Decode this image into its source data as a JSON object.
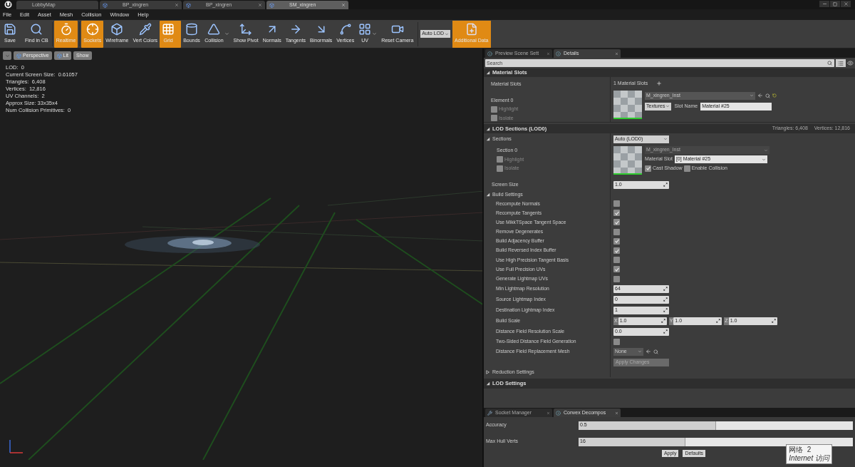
{
  "doc_tabs": [
    {
      "label": "LobbyMap",
      "selected": false,
      "closable": false
    },
    {
      "label": "BP_xingren",
      "selected": false,
      "closable": true
    },
    {
      "label": "BP_xingren",
      "selected": false,
      "closable": true
    },
    {
      "label": "SM_xingren",
      "selected": true,
      "closable": true
    }
  ],
  "menu": [
    "File",
    "Edit",
    "Asset",
    "Mesh",
    "Collision",
    "Window",
    "Help"
  ],
  "toolbar": {
    "items": [
      {
        "label": "Save",
        "on": false,
        "dropdown": false
      },
      {
        "label": "Find in CB",
        "on": false,
        "dropdown": false
      },
      {
        "label": "Realtime",
        "on": true,
        "dropdown": false
      },
      {
        "label": "Sockets",
        "on": true,
        "dropdown": false
      },
      {
        "label": "Wireframe",
        "on": false,
        "dropdown": false
      },
      {
        "label": "Vert Colors",
        "on": false,
        "dropdown": false
      },
      {
        "label": "Grid",
        "on": true,
        "dropdown": false
      },
      {
        "label": "Bounds",
        "on": false,
        "dropdown": false
      },
      {
        "label": "Collision",
        "on": false,
        "dropdown": true
      },
      {
        "label": "Show Pivot",
        "on": false,
        "dropdown": false
      },
      {
        "label": "Normals",
        "on": false,
        "dropdown": false
      },
      {
        "label": "Tangents",
        "on": false,
        "dropdown": false
      },
      {
        "label": "Binormals",
        "on": false,
        "dropdown": false
      },
      {
        "label": "Vertices",
        "on": false,
        "dropdown": false
      },
      {
        "label": "UV",
        "on": false,
        "dropdown": true
      },
      {
        "label": "Reset Camera",
        "on": false,
        "dropdown": false
      }
    ],
    "lod_dropdown": "Auto LOD",
    "additional": {
      "label": "Additional Data",
      "on": true
    }
  },
  "viewport": {
    "buttons": [
      "Perspective",
      "Lit",
      "Show"
    ],
    "stats": [
      "LOD:  0",
      "Current Screen Size:  0.61057",
      "Triangles:  6,408",
      "Vertices:  12,816",
      "UV Channels:  2",
      "Approx Size: 33x35x4",
      "Num Collision Primitives:  0"
    ]
  },
  "details_tabs": [
    {
      "label": "Preview Scene Sett",
      "selected": false
    },
    {
      "label": "Details",
      "selected": true
    }
  ],
  "search": {
    "placeholder": "Search"
  },
  "material_slots": {
    "header": "Material Slots",
    "expanded": true,
    "label": "Material Slots",
    "count": "1 Material Slots",
    "element": {
      "label": "Element 0",
      "highlight": {
        "label": "Highlight",
        "checked": false
      },
      "isolate": {
        "label": "Isolate",
        "checked": false
      },
      "material": "M_xingren_Inst",
      "textures": "Textures",
      "slot_name_label": "Slot Name",
      "slot_name": "Material #25"
    }
  },
  "lod_sections": {
    "header": "LOD Sections (LOD0)",
    "expanded": true,
    "triangles": "Triangles: 6,408",
    "vertices": "Vertices: 12,816",
    "sections_label": "Sections",
    "sections_expanded": true,
    "sections_value": "Auto (LOD0)",
    "section": {
      "label": "Section 0",
      "highlight": {
        "label": "Highlight",
        "checked": false
      },
      "isolate": {
        "label": "Isolate",
        "checked": false
      },
      "material": "M_xingren_Inst",
      "material_disabled": true,
      "slot_label": "Material Slot",
      "slot_value": "[0] Material #25",
      "cast_shadow": {
        "label": "Cast Shadow",
        "checked": true
      },
      "enable_collision": {
        "label": "Enable Collision",
        "checked": false
      }
    },
    "screen_size_label": "Screen Size",
    "screen_size": "1.0",
    "build_settings": {
      "label": "Build Settings",
      "expanded": true,
      "rows": [
        {
          "kind": "checkbox",
          "label": "Recompute Normals",
          "checked": false
        },
        {
          "kind": "checkbox",
          "label": "Recompute Tangents",
          "checked": true
        },
        {
          "kind": "checkbox",
          "label": "Use MikkTSpace Tangent Space",
          "checked": true
        },
        {
          "kind": "checkbox",
          "label": "Remove Degenerates",
          "checked": false
        },
        {
          "kind": "checkbox",
          "label": "Build Adjacency Buffer",
          "checked": true
        },
        {
          "kind": "checkbox",
          "label": "Build Reversed Index Buffer",
          "checked": true
        },
        {
          "kind": "checkbox",
          "label": "Use High Precision Tangent Basis",
          "checked": false
        },
        {
          "kind": "checkbox",
          "label": "Use Full Precision UVs",
          "checked": true
        },
        {
          "kind": "checkbox",
          "label": "Generate Lightmap UVs",
          "checked": false
        },
        {
          "kind": "number",
          "label": "Min Lightmap Resolution",
          "value": "64"
        },
        {
          "kind": "number",
          "label": "Source Lightmap Index",
          "value": "0"
        },
        {
          "kind": "number",
          "label": "Destination Lightmap Index",
          "value": "1"
        },
        {
          "kind": "vector",
          "label": "Build Scale",
          "axes": [
            {
              "axis": "X",
              "value": "1.0"
            },
            {
              "axis": "Y",
              "value": "1.0"
            },
            {
              "axis": "Z",
              "value": "1.0"
            }
          ]
        },
        {
          "kind": "number",
          "label": "Distance Field Resolution Scale",
          "value": "0.0"
        },
        {
          "kind": "checkbox",
          "label": "Two-Sided Distance Field Generation",
          "checked": false
        },
        {
          "kind": "asset",
          "label": "Distance Field Replacement Mesh",
          "value": "None"
        },
        {
          "kind": "button",
          "value": "Apply Changes"
        }
      ]
    },
    "reduction": {
      "label": "Reduction Settings",
      "expanded": false
    }
  },
  "lod_settings": {
    "header": "LOD Settings",
    "expanded": true
  },
  "bottom_tabs": [
    {
      "label": "Socket Manager",
      "selected": false
    },
    {
      "label": "Convex Decompos",
      "selected": true
    }
  ],
  "convex": {
    "rows": [
      {
        "label": "Accuracy",
        "value": "0.5",
        "level": 0.5
      },
      {
        "label": "Max Hull Verts",
        "value": "16",
        "level": 0.39
      }
    ],
    "buttons": [
      "Apply",
      "Defaults"
    ]
  },
  "tooltip": {
    "title": "网络  2",
    "subtitle": "Internet 访问"
  }
}
